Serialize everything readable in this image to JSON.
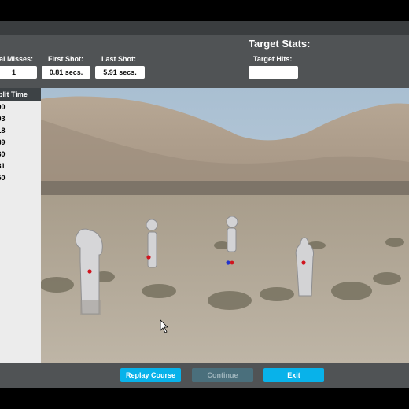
{
  "stats": {
    "total_misses_label": "al Misses:",
    "total_misses_value": "1",
    "first_shot_label": "First Shot:",
    "first_shot_value": "0.81 secs.",
    "last_shot_label": "Last Shot:",
    "last_shot_value": "5.91 secs."
  },
  "target_stats": {
    "title": "Target Stats:",
    "target_hits_label": "Target Hits:",
    "target_hits_value": ""
  },
  "split_times": {
    "header": "Split Time",
    "rows": [
      ".00",
      ".93",
      ".18",
      ".89",
      ".80",
      ".81",
      ".50"
    ]
  },
  "buttons": {
    "replay": "Replay Course",
    "continue": "Continue",
    "exit": "Exit"
  },
  "scene": {
    "target_hits": [
      {
        "target": "target-left",
        "color": "red"
      },
      {
        "target": "target-center-left",
        "color": "red"
      },
      {
        "target": "target-center",
        "color": "blue"
      },
      {
        "target": "target-center",
        "color": "red"
      },
      {
        "target": "target-right",
        "color": "red"
      }
    ]
  },
  "colors": {
    "window_bg": "#505355",
    "replay_button": "#08b2ea",
    "continue_button_disabled": "#4a6f7c",
    "exit_button": "#08b2ea",
    "hit_red": "#d0141e",
    "hit_blue": "#2233cc"
  }
}
